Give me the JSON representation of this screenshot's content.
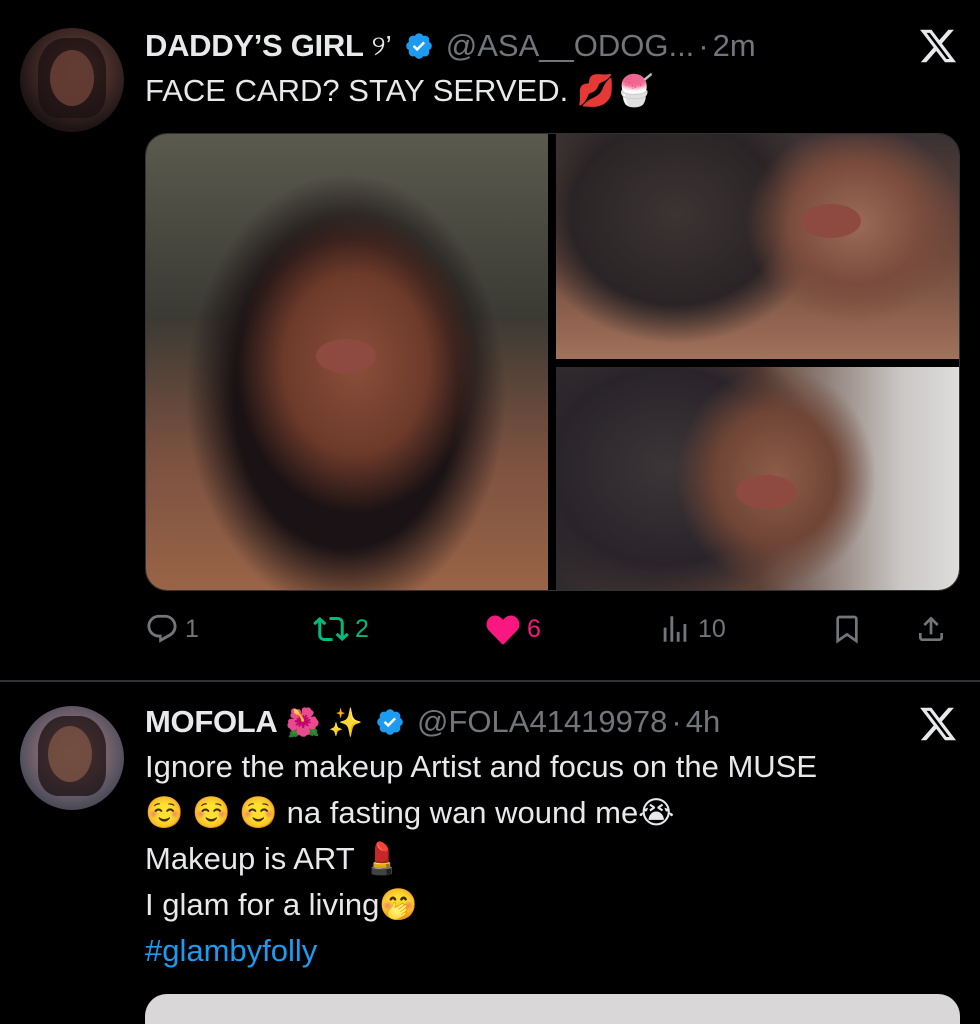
{
  "tweets": [
    {
      "name": "DADDY’S GIRL",
      "name_extra": "୨’",
      "handle": "@ASA__ODOG...",
      "separator": "·",
      "time": "2m",
      "text_lines": [
        "FACE CARD? STAY SERVED. 💋🍧"
      ],
      "actions": {
        "replies": "1",
        "retweets": "2",
        "likes": "6",
        "views": "10"
      },
      "icons": [
        "verified-badge-icon",
        "x-logo-icon",
        "reply-icon",
        "retweet-icon",
        "heart-icon",
        "views-icon",
        "bookmark-icon",
        "share-icon"
      ]
    },
    {
      "name": "MOFOLA",
      "name_extra": "🌺 ✨",
      "handle": "@FOLA41419978",
      "separator": "·",
      "time": "4h",
      "text_lines": [
        "Ignore the makeup Artist and focus on the MUSE",
        "☺️ ☺️ ☺️  na fasting wan wound me😭",
        "Makeup is ART 💄",
        "I glam for a living🤭"
      ],
      "hashtag": "#glambyfolly"
    }
  ],
  "colors": {
    "background": "#000000",
    "text": "#e7e9ea",
    "muted": "#71767b",
    "verified": "#1d9bf0",
    "retweet": "#00ba7c",
    "like": "#f91880",
    "hashtag": "#1d9bf0"
  }
}
